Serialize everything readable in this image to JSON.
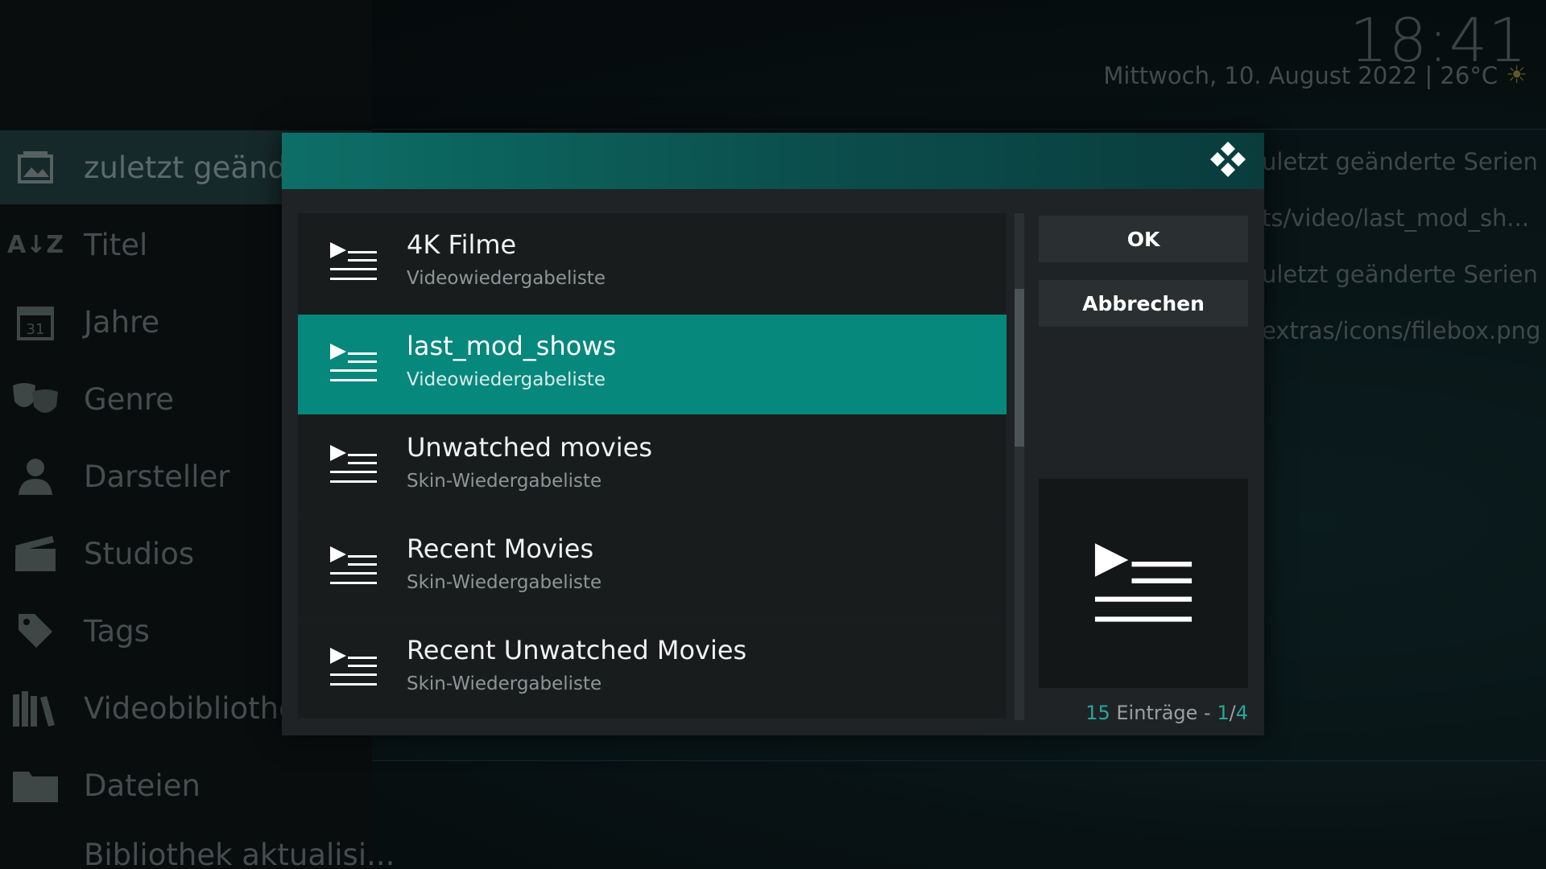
{
  "header": {
    "time": "18:41",
    "date_line": "Mittwoch, 10. August 2022 | 26°C",
    "weather_icon": "sun-icon"
  },
  "sidebar": {
    "items": [
      {
        "label": "zuletzt geände",
        "icon": "gallery-icon",
        "active": true
      },
      {
        "label": "Titel",
        "icon": "sort-az-icon"
      },
      {
        "label": "Jahre",
        "icon": "calendar-icon"
      },
      {
        "label": "Genre",
        "icon": "theater-masks-icon"
      },
      {
        "label": "Darsteller",
        "icon": "person-icon"
      },
      {
        "label": "Studios",
        "icon": "clapperboard-icon"
      },
      {
        "label": "Tags",
        "icon": "tag-icon"
      },
      {
        "label": "Videobibliothek",
        "icon": "books-icon"
      },
      {
        "label": "Dateien",
        "icon": "folder-icon"
      },
      {
        "label": "Bibliothek aktualisi...",
        "icon": ""
      }
    ]
  },
  "info_panel": {
    "lines": [
      "uletzt geänderte Serien",
      "ts/video/last_mod_sh...",
      "uletzt geänderte Serien",
      "extras/icons/filebox.png"
    ]
  },
  "dialog": {
    "logo_icon": "kodi-logo-icon",
    "items": [
      {
        "title": "4K Filme",
        "subtitle": "Videowiedergabeliste",
        "selected": false
      },
      {
        "title": "last_mod_shows",
        "subtitle": "Videowiedergabeliste",
        "selected": true
      },
      {
        "title": "Unwatched movies",
        "subtitle": "Skin-Wiedergabeliste",
        "selected": false
      },
      {
        "title": "Recent Movies",
        "subtitle": "Skin-Wiedergabeliste",
        "selected": false
      },
      {
        "title": "Recent Unwatched Movies",
        "subtitle": "Skin-Wiedergabeliste",
        "selected": false
      }
    ],
    "ok_label": "OK",
    "cancel_label": "Abbrechen",
    "preview_icon": "playlist-icon",
    "counter": {
      "count": "15",
      "label": " Einträge - ",
      "page": "1",
      "separator": "/",
      "pages": "4"
    },
    "scroll_position": 0.13,
    "accent_color": "#07887c"
  }
}
